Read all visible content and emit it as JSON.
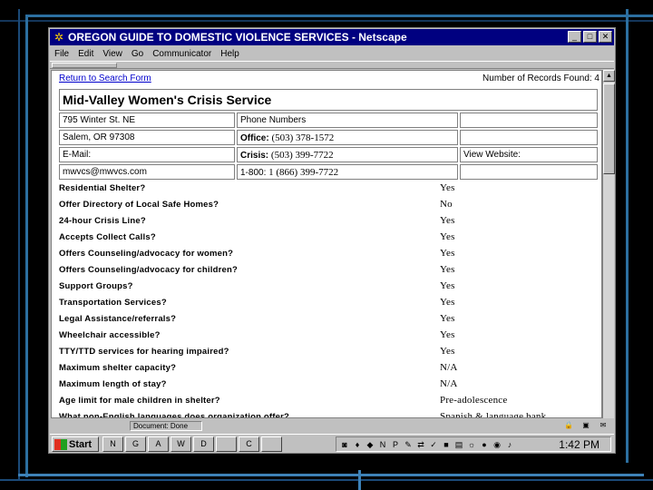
{
  "window": {
    "title": "OREGON GUIDE TO DOMESTIC VIOLENCE SERVICES - Netscape",
    "buttons": [
      "_",
      "□",
      "✕"
    ]
  },
  "menu": [
    "File",
    "Edit",
    "View",
    "Go",
    "Communicator",
    "Help"
  ],
  "page": {
    "return_link": "Return to Search Form",
    "records_found": "Number of Records Found: 4",
    "org_name": "Mid-Valley Women's Crisis Service",
    "address_line1": "795 Winter St. NE",
    "address_line2": "Salem, OR 97308",
    "phone_header": "Phone Numbers",
    "office_label": "Office:",
    "office_number": "(503) 378-1572",
    "email_label": "E-Mail:",
    "crisis_label": "Crisis:",
    "crisis_number": "(503) 399-7722",
    "website_label": "View Website:",
    "email_value": "mwvcs@mwvcs.com",
    "tollfree_label": "1-800:",
    "tollfree_number": "1 (866) 399-7722"
  },
  "services": [
    {
      "q": "Residential Shelter?",
      "a": "Yes"
    },
    {
      "q": "Offer Directory of Local Safe Homes?",
      "a": "No"
    },
    {
      "q": "24-hour Crisis Line?",
      "a": "Yes"
    },
    {
      "q": "Accepts Collect Calls?",
      "a": "Yes"
    },
    {
      "q": "Offers Counseling/advocacy for women?",
      "a": "Yes"
    },
    {
      "q": "Offers Counseling/advocacy for children?",
      "a": "Yes"
    },
    {
      "q": "Support Groups?",
      "a": "Yes"
    },
    {
      "q": "Transportation Services?",
      "a": "Yes"
    },
    {
      "q": "Legal Assistance/referrals?",
      "a": "Yes"
    },
    {
      "q": "Wheelchair accessible?",
      "a": "Yes"
    },
    {
      "q": "TTY/TTD services for hearing impaired?",
      "a": "Yes"
    },
    {
      "q": "Maximum shelter capacity?",
      "a": "N/A"
    },
    {
      "q": "Maximum length of stay?",
      "a": "N/A"
    },
    {
      "q": "Age limit for male children in shelter?",
      "a": "Pre-adolescence"
    },
    {
      "q": "What non-English languages does organization offer?",
      "a": "Spanish & language bank"
    }
  ],
  "status": {
    "text": "Document: Done"
  },
  "taskbar": {
    "start_label": "Start",
    "tasks": [
      "N",
      "G",
      "A",
      "W",
      "D",
      "",
      "C",
      ""
    ],
    "clock": "1:42 PM"
  },
  "colors": {
    "titlebar": "#000080",
    "link": "#0000cc",
    "frame": "#2c6fa0"
  }
}
